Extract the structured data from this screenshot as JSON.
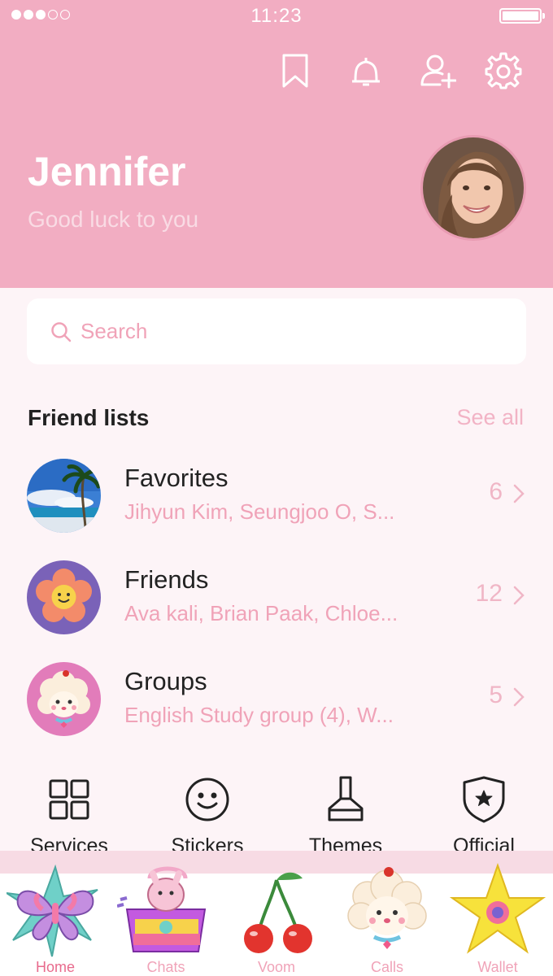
{
  "status_bar": {
    "time": "11:23"
  },
  "header_icons": [
    "bookmark-icon",
    "bell-icon",
    "add-friend-icon",
    "gear-icon"
  ],
  "profile": {
    "name": "Jennifer",
    "status_message": "Good luck to you"
  },
  "search": {
    "placeholder": "Search"
  },
  "friend_lists": {
    "title": "Friend lists",
    "see_all": "See all",
    "items": [
      {
        "name": "Favorites",
        "members": "Jihyun Kim, Seungjoo O, S...",
        "count": "6"
      },
      {
        "name": "Friends",
        "members": "Ava kali, Brian Paak, Chloe...",
        "count": "12"
      },
      {
        "name": "Groups",
        "members": "English Study group (4), W...",
        "count": "5"
      }
    ]
  },
  "services": [
    {
      "label": "Services",
      "icon": "grid-icon"
    },
    {
      "label": "Stickers",
      "icon": "smiley-icon"
    },
    {
      "label": "Themes",
      "icon": "brush-icon"
    },
    {
      "label": "Official",
      "icon": "shield-star-icon"
    }
  ],
  "tabs": [
    {
      "label": "Home",
      "icon": "butterfly-icon",
      "active": true
    },
    {
      "label": "Chats",
      "icon": "purse-icon",
      "active": false
    },
    {
      "label": "Voom",
      "icon": "cherries-icon",
      "active": false
    },
    {
      "label": "Calls",
      "icon": "poodle-icon",
      "active": false
    },
    {
      "label": "Wallet",
      "icon": "star-icon",
      "active": false
    }
  ],
  "colors": {
    "header_pink": "#f2adc2",
    "accent_pink": "#f0a3b8",
    "active_tab": "#e86b8d",
    "background": "#fdf4f7"
  }
}
